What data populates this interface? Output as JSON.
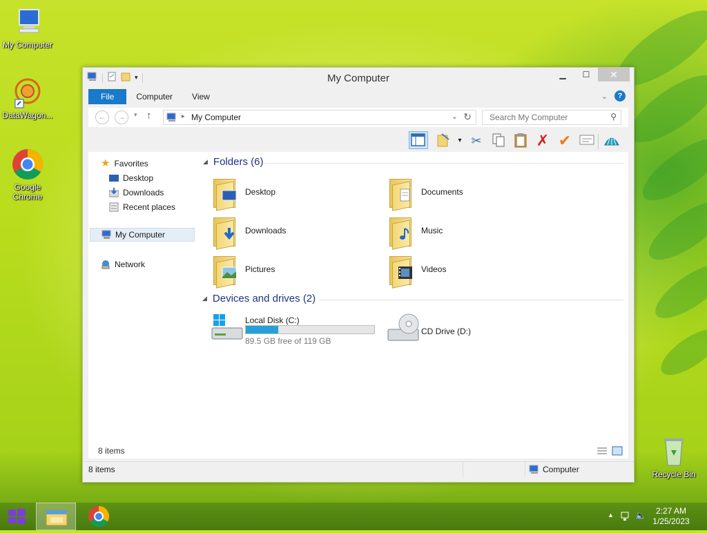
{
  "desktop": {
    "icons": [
      {
        "label": "My Computer"
      },
      {
        "label": "DataWagon..."
      },
      {
        "label": "Google Chrome"
      },
      {
        "label": "Recycle Bin"
      }
    ]
  },
  "window": {
    "title": "My Computer",
    "ribbon_tabs": [
      "File",
      "Computer",
      "View"
    ],
    "address": {
      "path": "My Computer"
    },
    "search": {
      "placeholder": "Search My Computer"
    },
    "sidebar": {
      "favorites_label": "Favorites",
      "favorites": [
        "Desktop",
        "Downloads",
        "Recent places"
      ],
      "computer_label": "My Computer",
      "network_label": "Network"
    },
    "folders": {
      "header": "Folders (6)",
      "items": [
        "Desktop",
        "Documents",
        "Downloads",
        "Music",
        "Pictures",
        "Videos"
      ]
    },
    "devices": {
      "header": "Devices and drives (2)",
      "items": [
        {
          "name": "Local Disk (C:)",
          "free": "89.5 GB free of 119 GB",
          "used_fraction": 0.25
        },
        {
          "name": "CD Drive (D:)"
        }
      ]
    },
    "items_count_inner": "8 items",
    "status": {
      "items": "8 items",
      "location": "Computer"
    }
  },
  "taskbar": {
    "clock": {
      "time": "2:27 AM",
      "date": "1/25/2023"
    }
  },
  "colors": {
    "accent": "#1979ca",
    "drive_fill": "#26a0da",
    "group_header": "#1e3287"
  }
}
